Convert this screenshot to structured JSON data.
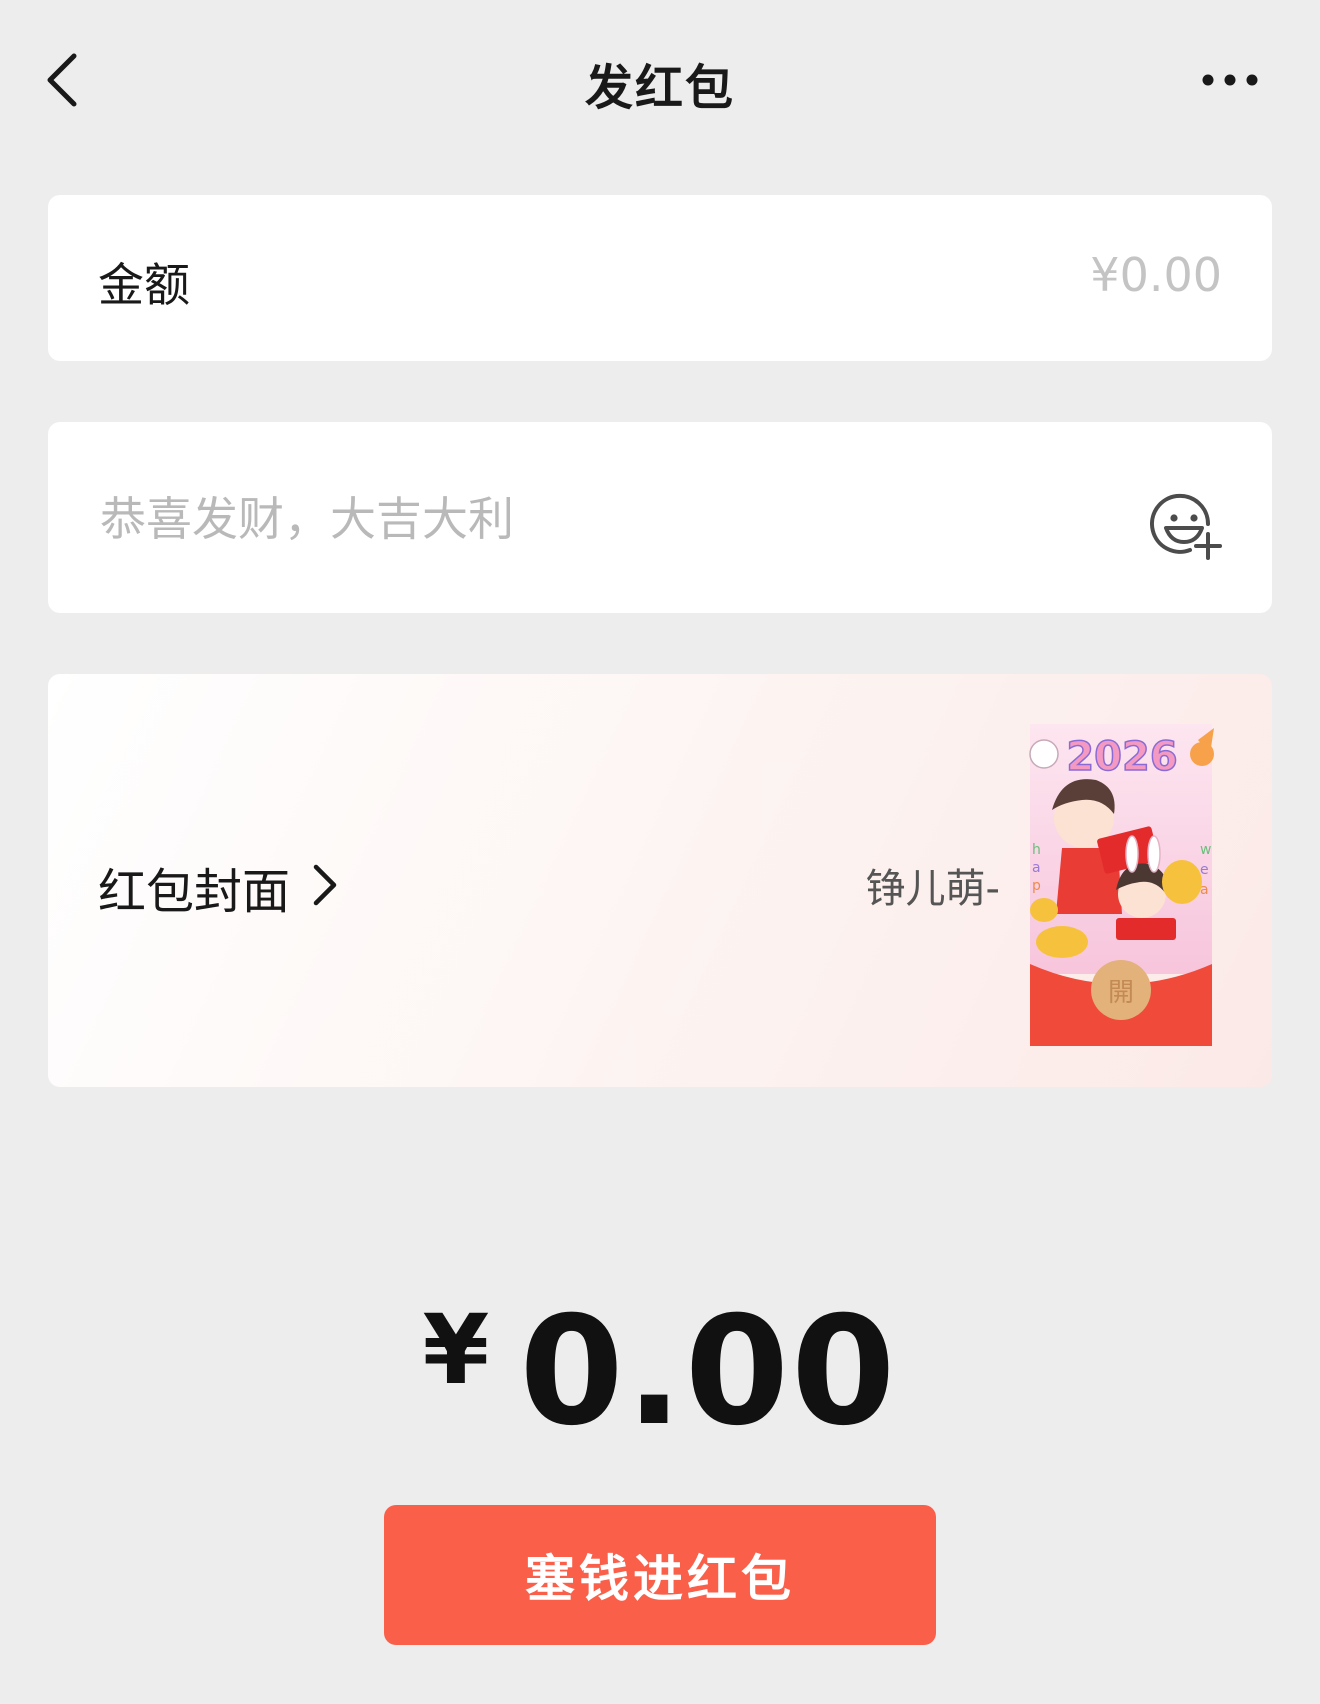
{
  "header": {
    "title": "发红包",
    "back_icon": "chevron-left-icon",
    "more_icon": "more-horizontal-icon"
  },
  "amount": {
    "label": "金额",
    "placeholder": "¥0.00"
  },
  "greeting": {
    "placeholder": "恭喜发财，大吉大利",
    "emoji_icon": "emoji-add-icon"
  },
  "cover": {
    "label": "红包封面",
    "author": "铮儿萌-",
    "thumb": {
      "year": "2026",
      "open_char": "開",
      "colors": {
        "envelope_red": "#f04b3a",
        "background_pink": "#fbd3e4",
        "coin_gold": "#f6c23e"
      }
    }
  },
  "total": {
    "currency": "¥",
    "value": "0.00"
  },
  "submit": {
    "label": "塞钱进红包"
  },
  "colors": {
    "background": "#ededed",
    "accent": "#fa5f4a",
    "card": "#ffffff",
    "placeholder": "#c4c4c4"
  }
}
